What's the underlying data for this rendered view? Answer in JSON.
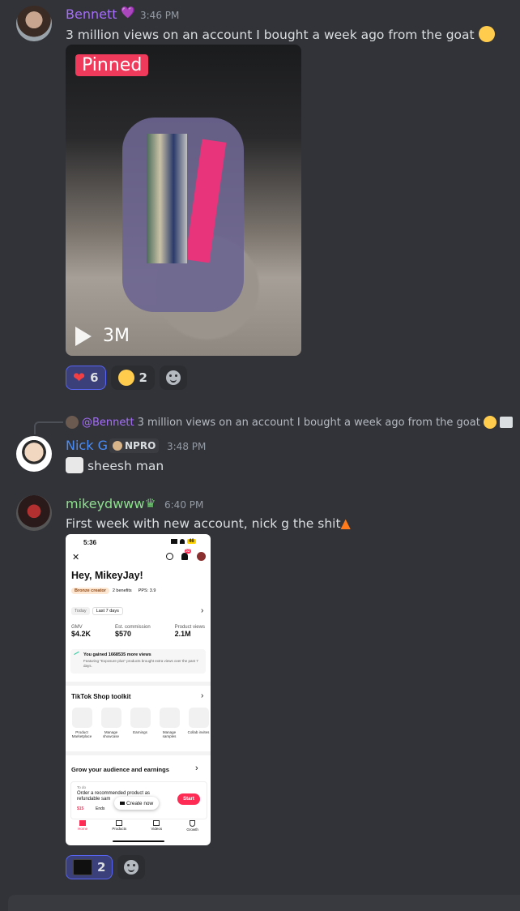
{
  "messages": [
    {
      "username": "Bennett",
      "username_color": "#a66efb",
      "time": "3:46 PM",
      "text": "3 million views on an account I bought a week ago from the goat",
      "text_emoji": "saluting-face",
      "video": {
        "badge": "Pinned",
        "views": "3M"
      },
      "reactions": [
        {
          "emoji": "heart",
          "count": "6",
          "me": true
        },
        {
          "emoji": "saluting-face",
          "count": "2",
          "me": false
        }
      ]
    },
    {
      "reply": {
        "author": "@Bennett",
        "text": "3 million views on an account I bought a week ago from the goat"
      },
      "username": "Nick G",
      "username_color": "#4b8cf4",
      "tag": "NPRO",
      "time": "3:48 PM",
      "text": "sheesh man",
      "text_emoji": "goat"
    },
    {
      "username": "mikeydwww",
      "username_color": "#8ee08e",
      "time": "6:40 PM",
      "text": "First week with new account, nick g the shit",
      "text_emoji": "fire",
      "reactions": [
        {
          "emoji": "server-logo",
          "count": "2",
          "me": true
        }
      ]
    }
  ],
  "screenshot": {
    "status_time": "5:36",
    "battery": "46",
    "notif_badge": "33",
    "greeting": "Hey, MikeyJay!",
    "creator_badge": "Bronze creator",
    "benefits": "2 benefits",
    "pps": "PPS: 3.9",
    "date_tabs": [
      "Today",
      "Last 7 days"
    ],
    "stats": [
      {
        "label": "GMV",
        "value": "$4.2K"
      },
      {
        "label": "Est. commission",
        "value": "$570"
      },
      {
        "label": "Product views",
        "value": "2.1M"
      }
    ],
    "gain_title": "You gained 1668535 more views",
    "gain_desc": "Featuring \"Exposure plus\" products brought extra views over the past 7 days.",
    "toolkit_title": "TikTok Shop toolkit",
    "toolkit_items": [
      "Product Marketplace",
      "Manage showcase",
      "Earnings",
      "Manage samples",
      "Collab invites"
    ],
    "grow_title": "Grow your audience and earnings",
    "todo_label": "To do",
    "todo_text": "Order a recommended product as refundable sam",
    "todo_price": "$15",
    "todo_ends": "Ends",
    "create_now": "Create now",
    "start": "Start",
    "nav": [
      "Home",
      "Products",
      "Videos",
      "Growth"
    ]
  }
}
